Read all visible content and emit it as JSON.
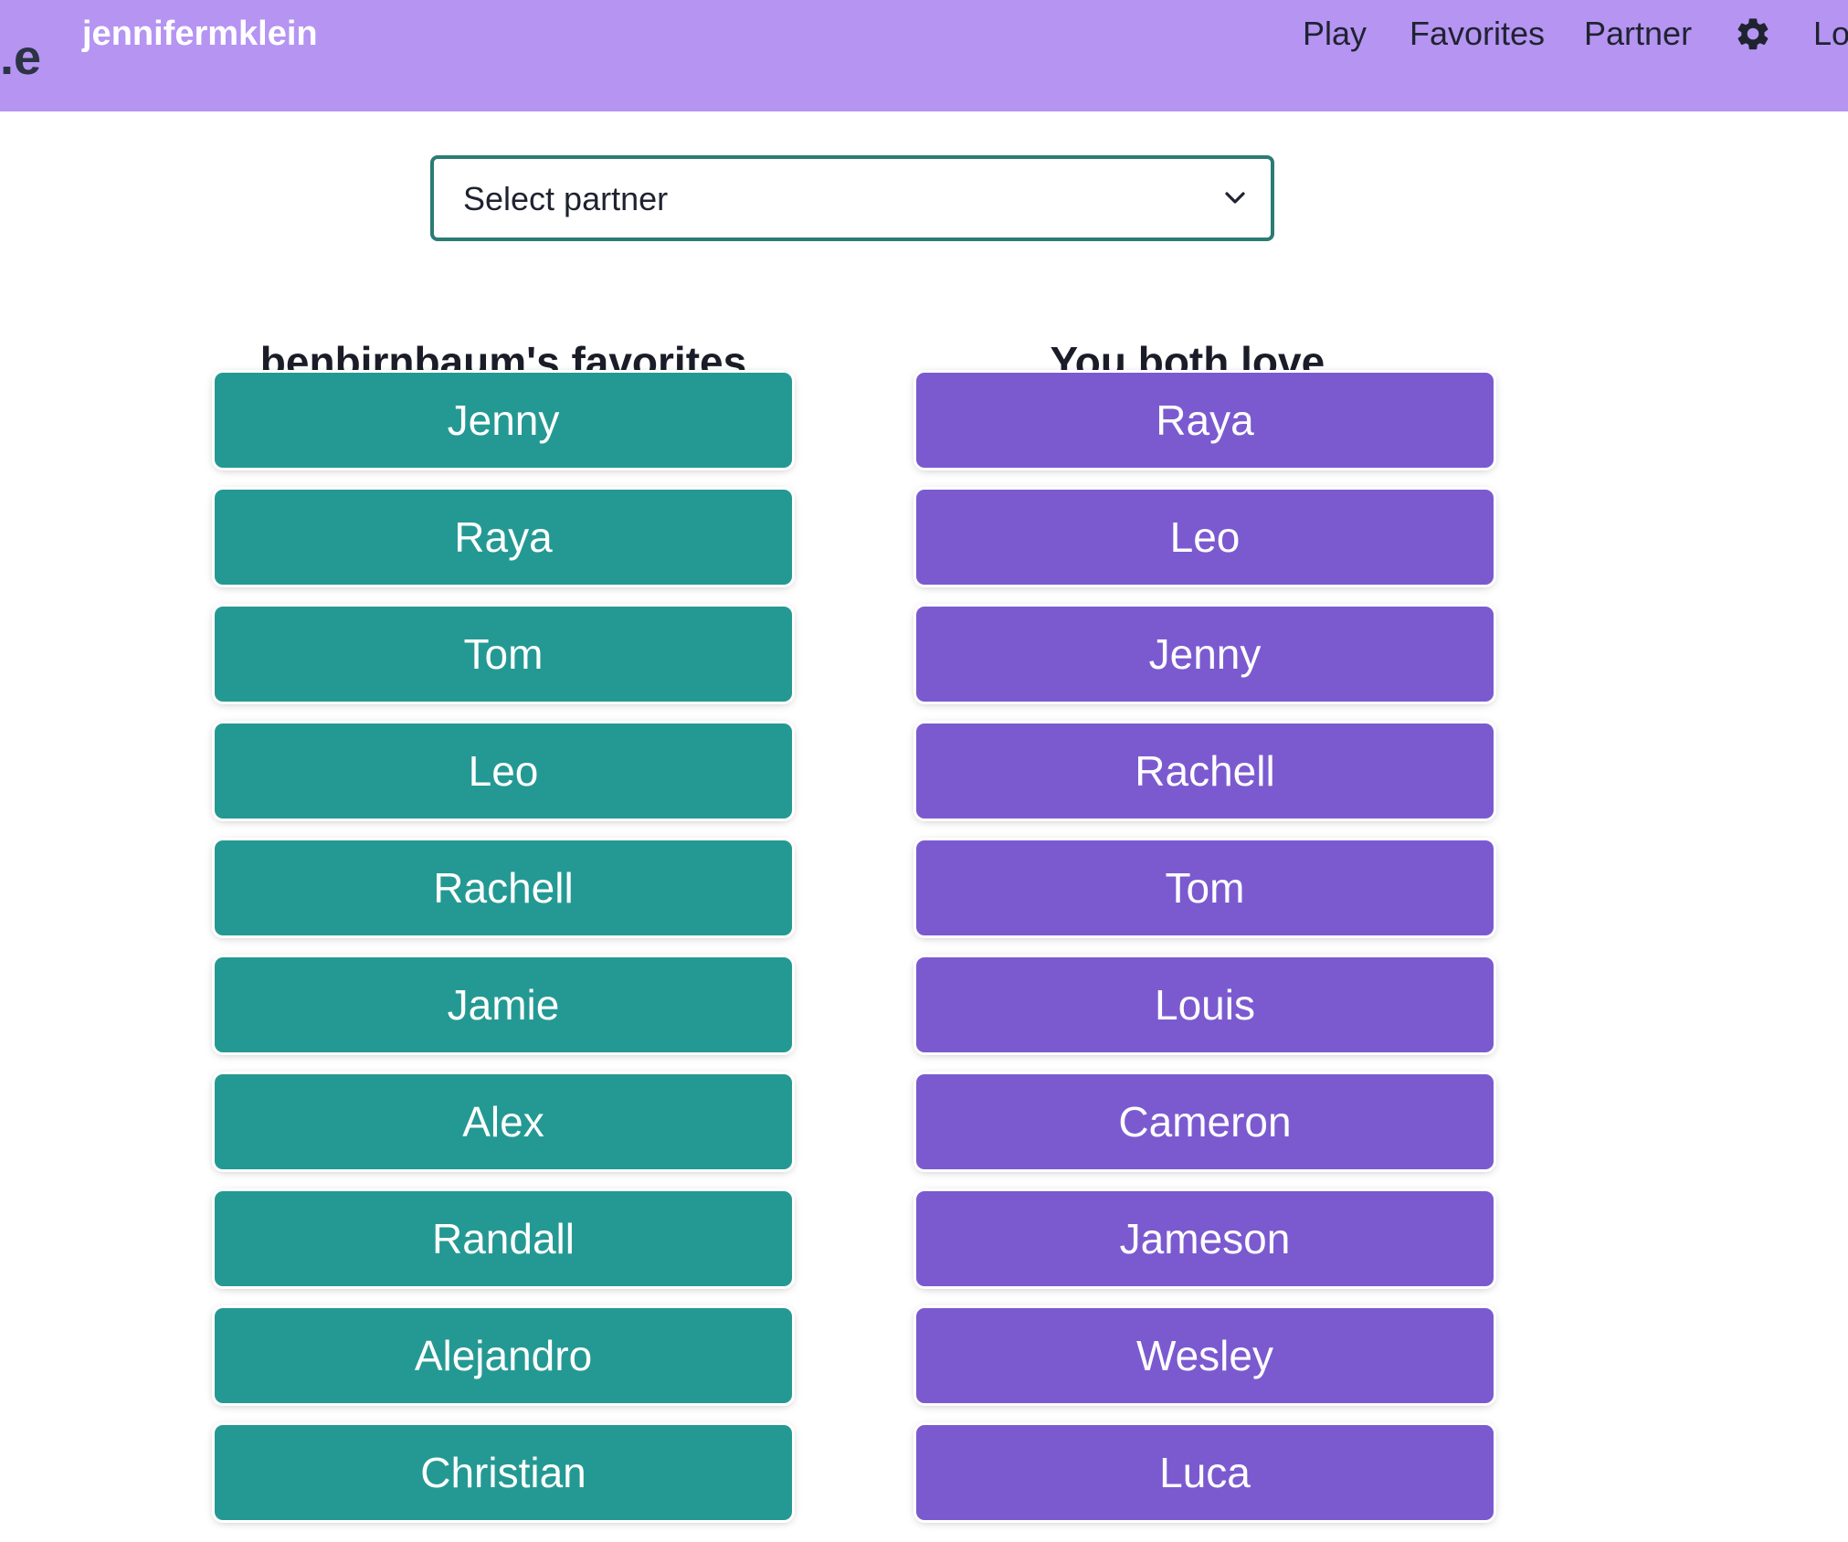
{
  "navbar": {
    "brand_partial": ".e",
    "username": "jennifermklein",
    "links": [
      "Play",
      "Favorites",
      "Partner"
    ],
    "settings_icon": "gear-icon",
    "last_link_partial": "Lo",
    "background": "#b594f2"
  },
  "partner_select": {
    "selected": "Select partner",
    "icon": "chevron-down-icon",
    "border_color": "#2a7c74"
  },
  "left_column": {
    "title": "benbirnbaum's favorites",
    "color": "#249993",
    "names": [
      "Jenny",
      "Raya",
      "Tom",
      "Leo",
      "Rachell",
      "Jamie",
      "Alex",
      "Randall",
      "Alejandro",
      "Christian"
    ]
  },
  "right_column": {
    "title": "You both love...",
    "color": "#7b5ad0",
    "names": [
      "Raya",
      "Leo",
      "Jenny",
      "Rachell",
      "Tom",
      "Louis",
      "Cameron",
      "Jameson",
      "Wesley",
      "Luca"
    ]
  }
}
